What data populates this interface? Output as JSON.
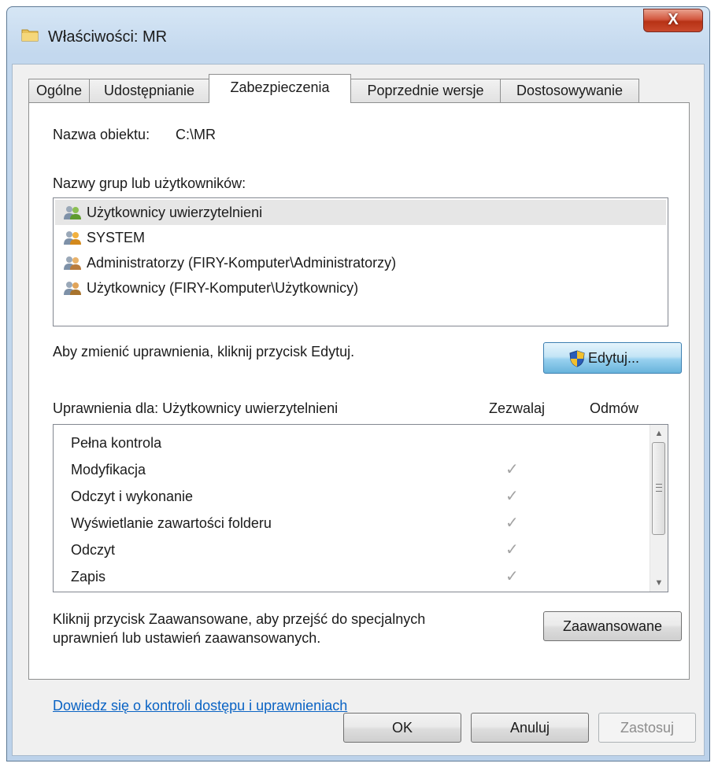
{
  "window": {
    "title": "Właściwości: MR",
    "close_label": "X"
  },
  "tabs": [
    {
      "label": "Ogólne"
    },
    {
      "label": "Udostępnianie"
    },
    {
      "label": "Zabezpieczenia",
      "active": true
    },
    {
      "label": "Poprzednie wersje"
    },
    {
      "label": "Dostosowywanie"
    }
  ],
  "object_name": {
    "label": "Nazwa obiektu:",
    "value": "C:\\MR"
  },
  "groups": {
    "label": "Nazwy grup lub użytkowników:",
    "items": [
      {
        "name": "Użytkownicy uwierzytelnieni",
        "selected": true
      },
      {
        "name": "SYSTEM"
      },
      {
        "name": "Administratorzy (FIRY-Komputer\\Administratorzy)"
      },
      {
        "name": "Użytkownicy (FIRY-Komputer\\Użytkownicy)"
      }
    ]
  },
  "edit": {
    "hint": "Aby zmienić uprawnienia, kliknij przycisk Edytuj.",
    "button_label": "Edytuj..."
  },
  "permissions": {
    "header": "Uprawnienia dla: Użytkownicy uwierzytelnieni",
    "allow_col": "Zezwalaj",
    "deny_col": "Odmów",
    "rows": [
      {
        "label": "Pełna kontrola",
        "allow": false
      },
      {
        "label": "Modyfikacja",
        "allow": true
      },
      {
        "label": "Odczyt i wykonanie",
        "allow": true
      },
      {
        "label": "Wyświetlanie zawartości folderu",
        "allow": true
      },
      {
        "label": "Odczyt",
        "allow": true
      },
      {
        "label": "Zapis",
        "allow": true
      }
    ]
  },
  "advanced": {
    "line1": "Kliknij przycisk Zaawansowane, aby przejść do specjalnych",
    "line2": "uprawnień lub ustawień zaawansowanych.",
    "button_label": "Zaawansowane"
  },
  "link": "Dowiedz się o kontroli dostępu i uprawnieniach",
  "footer": {
    "ok": "OK",
    "cancel": "Anuluj",
    "apply": "Zastosuj"
  },
  "icons": {
    "window": "folder-icon",
    "user": "user-group-icon",
    "edit": "uac-shield-icon",
    "check": "checkmark-icon"
  }
}
